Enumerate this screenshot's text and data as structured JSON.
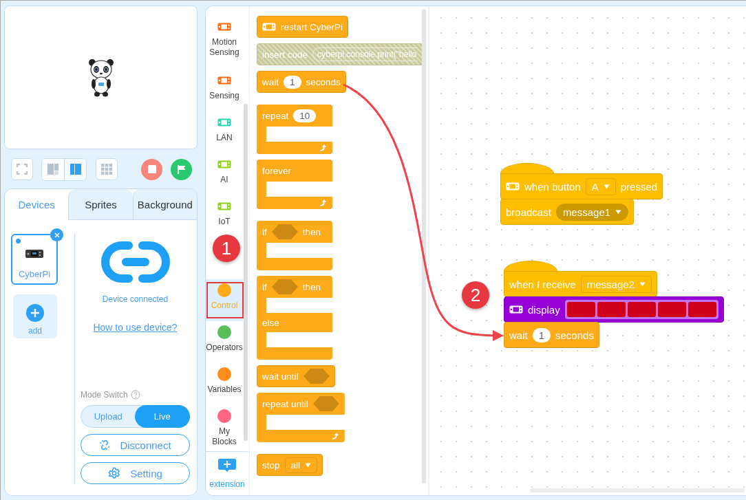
{
  "toolbar": {
    "layout_buttons": [
      {
        "selected": false
      },
      {
        "selected": true
      }
    ]
  },
  "tabs": [
    {
      "label": "Devices",
      "selected": true
    },
    {
      "label": "Sprites",
      "selected": false
    },
    {
      "label": "Background",
      "selected": false
    }
  ],
  "devices": [
    {
      "name": "CyberPi",
      "selected": true
    }
  ],
  "add_device": {
    "label": "add"
  },
  "connection": {
    "status": "Device connected",
    "help_link": "How to use device?"
  },
  "mode_switch": {
    "label": "Mode Switch",
    "options": [
      {
        "label": "Upload",
        "selected": false
      },
      {
        "label": "Live",
        "selected": true
      }
    ]
  },
  "actions": [
    {
      "kind": "disconnect",
      "label": "Disconnect"
    },
    {
      "kind": "setting",
      "label": "Setting"
    }
  ],
  "categories": [
    {
      "label": "Motion Sensing",
      "kind": "device",
      "color": "#ff6a13",
      "selected": false
    },
    {
      "label": "Sensing",
      "kind": "device",
      "color": "#ff6a13",
      "selected": false
    },
    {
      "label": "LAN",
      "kind": "device",
      "color": "#2ed3b0",
      "selected": false
    },
    {
      "label": "AI",
      "kind": "device",
      "color": "#8fd11b",
      "selected": false
    },
    {
      "label": "IoT",
      "kind": "device",
      "color": "#8fd11b",
      "selected": false
    },
    {
      "kind": "covered",
      "selected": false
    },
    {
      "label": "Control",
      "kind": "dot",
      "color": "#ffab19",
      "selected": true
    },
    {
      "label": "Operators",
      "kind": "dot",
      "color": "#59c059",
      "selected": false
    },
    {
      "label": "Variables",
      "kind": "dot",
      "color": "#ff8c1a",
      "selected": false
    },
    {
      "label": "My Blocks",
      "kind": "dot",
      "color": "#ff6680",
      "selected": false
    }
  ],
  "extension": {
    "label": "extension"
  },
  "palette": {
    "groups": [
      {
        "blocks": [
          {
            "kind": "stack",
            "color": "#ffab19",
            "disabled": false,
            "parts": [
              {
                "kind": "icon"
              },
              {
                "kind": "text",
                "text": "restart CyberPi"
              }
            ]
          },
          {
            "kind": "stack",
            "disabled": true,
            "parts": [
              {
                "kind": "text",
                "text": "insert code"
              },
              {
                "kind": "code",
                "text": "cyberpi.console.print(\"hello"
              }
            ]
          },
          {
            "kind": "stack",
            "color": "#ffab19",
            "disabled": false,
            "parts": [
              {
                "kind": "text",
                "text": "wait"
              },
              {
                "kind": "number",
                "text": "1"
              },
              {
                "kind": "text",
                "text": "seconds"
              }
            ]
          }
        ]
      },
      {
        "blocks": [
          {
            "kind": "c",
            "color": "#ffab19",
            "disabled": false,
            "loop": true,
            "parts": [
              {
                "kind": "text",
                "text": "repeat"
              },
              {
                "kind": "number",
                "text": "10"
              }
            ]
          },
          {
            "kind": "c",
            "color": "#ffab19",
            "disabled": false,
            "loop": true,
            "parts": [
              {
                "kind": "text",
                "text": "forever"
              }
            ]
          }
        ]
      },
      {
        "blocks": [
          {
            "kind": "c",
            "color": "#ffab19",
            "disabled": false,
            "loop": false,
            "parts": [
              {
                "kind": "text",
                "text": "if"
              },
              {
                "kind": "hex"
              },
              {
                "kind": "text",
                "text": "then"
              }
            ]
          },
          {
            "kind": "ifelse",
            "color": "#ffab19",
            "disabled": false,
            "loop": false,
            "parts": [
              {
                "kind": "text",
                "text": "if"
              },
              {
                "kind": "hex"
              },
              {
                "kind": "text",
                "text": "then"
              }
            ],
            "else_parts": [
              {
                "kind": "text",
                "text": "else"
              }
            ]
          },
          {
            "kind": "stack",
            "color": "#ffab19",
            "disabled": false,
            "parts": [
              {
                "kind": "text",
                "text": "wait until"
              },
              {
                "kind": "hex"
              }
            ]
          },
          {
            "kind": "c",
            "color": "#ffab19",
            "disabled": false,
            "loop": true,
            "parts": [
              {
                "kind": "text",
                "text": "repeat until"
              },
              {
                "kind": "hex"
              }
            ]
          }
        ]
      },
      {
        "blocks": [
          {
            "kind": "stack",
            "color": "#ffab19",
            "disabled": false,
            "parts": [
              {
                "kind": "text",
                "text": "stop"
              },
              {
                "kind": "dropdown",
                "text": "all"
              }
            ]
          }
        ]
      }
    ]
  },
  "canvas": {
    "stacks": [
      {
        "blocks": [
          {
            "kind": "hat",
            "color": "#ffbf00",
            "parts": [
              {
                "kind": "icon"
              },
              {
                "kind": "text",
                "text": "when button"
              },
              {
                "kind": "dropdown",
                "text": "A"
              },
              {
                "kind": "text",
                "text": "pressed"
              }
            ]
          },
          {
            "kind": "stack",
            "color": "#ffbf00",
            "parts": [
              {
                "kind": "text",
                "text": "broadcast"
              },
              {
                "kind": "round-dropdown",
                "text": "message1"
              }
            ]
          }
        ]
      },
      {
        "blocks": [
          {
            "kind": "hat",
            "color": "#ffbf00",
            "parts": [
              {
                "kind": "text",
                "text": "when I receive"
              },
              {
                "kind": "dropdown",
                "text": "message2"
              }
            ]
          },
          {
            "kind": "stack",
            "color": "#9400d6",
            "parts": [
              {
                "kind": "icon"
              },
              {
                "kind": "text",
                "text": "display"
              },
              {
                "kind": "matrix"
              }
            ]
          },
          {
            "kind": "stack",
            "color": "#ffab19",
            "parts": [
              {
                "kind": "text",
                "text": "wait"
              },
              {
                "kind": "number",
                "text": "1"
              },
              {
                "kind": "text",
                "text": "seconds"
              }
            ]
          }
        ]
      }
    ]
  },
  "callouts": [
    {
      "number": "1"
    },
    {
      "number": "2"
    }
  ]
}
